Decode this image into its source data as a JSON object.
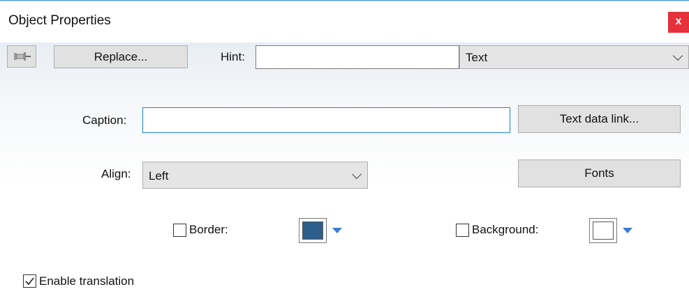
{
  "window": {
    "title": "Object Properties",
    "close_glyph": "x"
  },
  "toolbar": {
    "pin_icon": "pin-icon",
    "replace_label": "Replace...",
    "hint_label": "Hint:",
    "hint_value": "",
    "type_selected": "Text"
  },
  "caption": {
    "label": "Caption:",
    "value": "",
    "link_button": "Text data link..."
  },
  "align": {
    "label": "Align:",
    "selected": "Left",
    "fonts_button": "Fonts"
  },
  "border": {
    "label": "Border:",
    "checked": false,
    "color": "#2e5f8a"
  },
  "background": {
    "label": "Background:",
    "checked": false,
    "color": "#ffffff"
  },
  "translation": {
    "label": "Enable translation",
    "checked": true
  },
  "colors": {
    "close_button": "#e6303a",
    "focus_border": "#1c7fd6",
    "dropdown_arrow": "#3b7bd4"
  }
}
